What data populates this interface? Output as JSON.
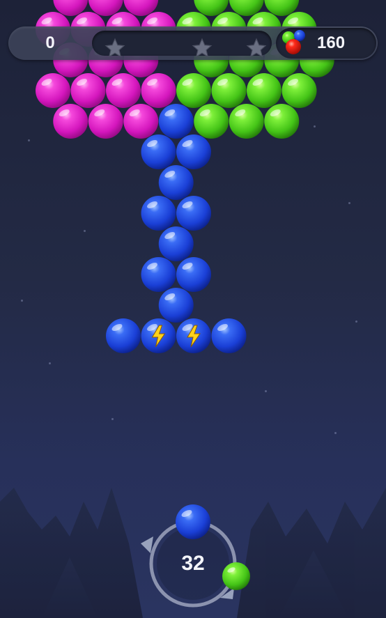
{
  "game": {
    "score": "0",
    "bubble_count": "160",
    "moves_left": "32",
    "stars": {
      "earned": 0,
      "total": 3
    },
    "progress": 0,
    "current_bubble": "blue",
    "next_bubble": "green"
  },
  "colors": {
    "pink": "#e21ec9",
    "green": "#4fd61a",
    "blue": "#1a46e0",
    "accent_star": "#6a6f82"
  },
  "icons": {
    "stars": "star-icon",
    "bubble_counter": "colored-balls-icon",
    "lightning": "lightning-bolt-icon",
    "swap": "swap-arrows-icon"
  },
  "bubbles": [
    {
      "c": "pink",
      "r": 0,
      "col": 0
    },
    {
      "c": "pink",
      "r": 0,
      "col": 1
    },
    {
      "c": "pink",
      "r": 0,
      "col": 2
    },
    {
      "c": "green",
      "r": 0,
      "col": 4
    },
    {
      "c": "green",
      "r": 0,
      "col": 5
    },
    {
      "c": "green",
      "r": 0,
      "col": 6
    },
    {
      "c": "pink",
      "r": 1,
      "col": 0
    },
    {
      "c": "pink",
      "r": 1,
      "col": 1
    },
    {
      "c": "pink",
      "r": 1,
      "col": 2
    },
    {
      "c": "pink",
      "r": 1,
      "col": 3
    },
    {
      "c": "green",
      "r": 1,
      "col": 4
    },
    {
      "c": "green",
      "r": 1,
      "col": 5
    },
    {
      "c": "green",
      "r": 1,
      "col": 6
    },
    {
      "c": "green",
      "r": 1,
      "col": 7
    },
    {
      "c": "pink",
      "r": 2,
      "col": 0
    },
    {
      "c": "pink",
      "r": 2,
      "col": 1
    },
    {
      "c": "pink",
      "r": 2,
      "col": 2
    },
    {
      "c": "green",
      "r": 2,
      "col": 4
    },
    {
      "c": "green",
      "r": 2,
      "col": 5
    },
    {
      "c": "green",
      "r": 2,
      "col": 6
    },
    {
      "c": "green",
      "r": 2,
      "col": 7
    },
    {
      "c": "pink",
      "r": 3,
      "col": 0
    },
    {
      "c": "pink",
      "r": 3,
      "col": 1
    },
    {
      "c": "pink",
      "r": 3,
      "col": 2
    },
    {
      "c": "pink",
      "r": 3,
      "col": 3
    },
    {
      "c": "green",
      "r": 3,
      "col": 4
    },
    {
      "c": "green",
      "r": 3,
      "col": 5
    },
    {
      "c": "green",
      "r": 3,
      "col": 6
    },
    {
      "c": "green",
      "r": 3,
      "col": 7
    },
    {
      "c": "pink",
      "r": 4,
      "col": 0
    },
    {
      "c": "pink",
      "r": 4,
      "col": 1
    },
    {
      "c": "pink",
      "r": 4,
      "col": 2
    },
    {
      "c": "blue",
      "r": 4,
      "col": 3
    },
    {
      "c": "green",
      "r": 4,
      "col": 4
    },
    {
      "c": "green",
      "r": 4,
      "col": 5
    },
    {
      "c": "green",
      "r": 4,
      "col": 6
    },
    {
      "c": "blue",
      "r": 5,
      "col": 3
    },
    {
      "c": "blue",
      "r": 5,
      "col": 4
    },
    {
      "c": "blue",
      "r": 6,
      "col": 3
    },
    {
      "c": "blue",
      "r": 7,
      "col": 3
    },
    {
      "c": "blue",
      "r": 7,
      "col": 4
    },
    {
      "c": "blue",
      "r": 8,
      "col": 3
    },
    {
      "c": "blue",
      "r": 9,
      "col": 3
    },
    {
      "c": "blue",
      "r": 9,
      "col": 4
    },
    {
      "c": "blue",
      "r": 10,
      "col": 3
    },
    {
      "c": "blue",
      "r": 11,
      "col": 2
    },
    {
      "c": "blue",
      "r": 11,
      "col": 3,
      "bolt": true
    },
    {
      "c": "blue",
      "r": 11,
      "col": 4,
      "bolt": true
    },
    {
      "c": "blue",
      "r": 11,
      "col": 5
    }
  ]
}
